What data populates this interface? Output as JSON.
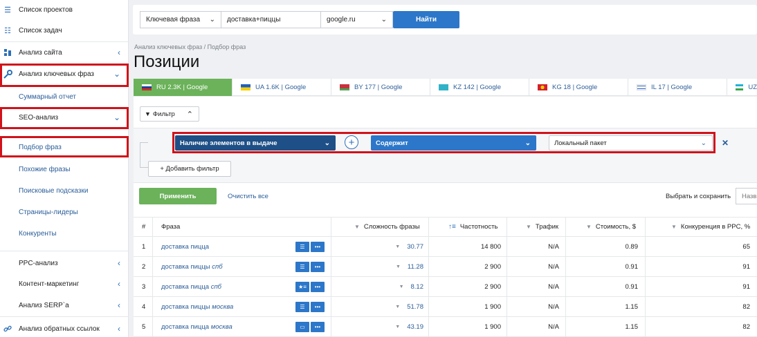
{
  "sidebar": {
    "items": [
      {
        "label": "Список проектов",
        "icon": "menu-icon"
      },
      {
        "label": "Список задач",
        "icon": "list-icon"
      },
      {
        "label": "Анализ сайта",
        "icon": "site-analysis-icon"
      },
      {
        "label": "Анализ ключевых фраз",
        "icon": "key-icon"
      },
      {
        "label": "Суммарный отчет"
      },
      {
        "label": "SEO-анализ"
      },
      {
        "label": "Подбор фраз"
      },
      {
        "label": "Похожие фразы"
      },
      {
        "label": "Поисковые подсказки"
      },
      {
        "label": "Страницы-лидеры"
      },
      {
        "label": "Конкуренты"
      },
      {
        "label": "PPC-анализ"
      },
      {
        "label": "Контент-маркетинг"
      },
      {
        "label": "Анализ SERP`а"
      },
      {
        "label": "Анализ обратных ссылок",
        "icon": "link-icon"
      }
    ]
  },
  "search": {
    "type_value": "Ключевая фраза",
    "query_value": "доставка+пиццы",
    "engine_value": "google.ru",
    "button_label": "Найти"
  },
  "header": {
    "breadcrumb": "Анализ ключевых фраз / Подбор фраз",
    "title": "Позиции"
  },
  "tabs": [
    {
      "label": "RU 2.3K | Google",
      "flag": "ru"
    },
    {
      "label": "UA 1.6K | Google",
      "flag": "ua"
    },
    {
      "label": "BY 177 | Google",
      "flag": "by"
    },
    {
      "label": "KZ 142 | Google",
      "flag": "kz"
    },
    {
      "label": "KG 18 | Google",
      "flag": "kg"
    },
    {
      "label": "IL 17 | Google",
      "flag": "il"
    },
    {
      "label": "UZ",
      "flag": "uz"
    }
  ],
  "filter": {
    "toggle_label": "Фильтр",
    "field_value": "Наличие элементов в выдаче",
    "operator_value": "Содержит",
    "value_value": "Локальный пакет",
    "add_label": "+ Добавить фильтр",
    "apply_label": "Применить",
    "clear_label": "Очистить все",
    "save_label": "Выбрать и сохранить",
    "save_placeholder": "Назв"
  },
  "table": {
    "headers": {
      "num": "#",
      "phrase": "Фраза",
      "difficulty": "Сложность фразы",
      "frequency": "Частотность",
      "traffic": "Трафик",
      "cost": "Стоимость, $",
      "competition": "Конкуренция в PPC, %"
    },
    "rows": [
      {
        "num": "1",
        "phrase": "доставка пицца",
        "phrase_suffix": "",
        "difficulty": "30.77",
        "frequency": "14 800",
        "traffic": "N/A",
        "cost": "0.89",
        "competition": "65",
        "icon1": "list-icon"
      },
      {
        "num": "2",
        "phrase": "доставка пиццы",
        "phrase_suffix": "спб",
        "difficulty": "11.28",
        "frequency": "2 900",
        "traffic": "N/A",
        "cost": "0.91",
        "competition": "91",
        "icon1": "list-icon"
      },
      {
        "num": "3",
        "phrase": "доставка пицца",
        "phrase_suffix": "спб",
        "difficulty": "8.12",
        "frequency": "2 900",
        "traffic": "N/A",
        "cost": "0.91",
        "competition": "91",
        "icon1": "star-list-icon"
      },
      {
        "num": "4",
        "phrase": "доставка пиццы",
        "phrase_suffix": "москва",
        "difficulty": "51.78",
        "frequency": "1 900",
        "traffic": "N/A",
        "cost": "1.15",
        "competition": "82",
        "icon1": "list-icon"
      },
      {
        "num": "5",
        "phrase": "доставка пицца",
        "phrase_suffix": "москва",
        "difficulty": "43.19",
        "frequency": "1 900",
        "traffic": "N/A",
        "cost": "1.15",
        "competition": "82",
        "icon1": "comment-icon"
      }
    ]
  },
  "colors": {
    "accent_blue": "#2c77c9",
    "dark_blue": "#1e4f86",
    "green": "#6bb25a",
    "highlight_red": "#d0121a"
  }
}
